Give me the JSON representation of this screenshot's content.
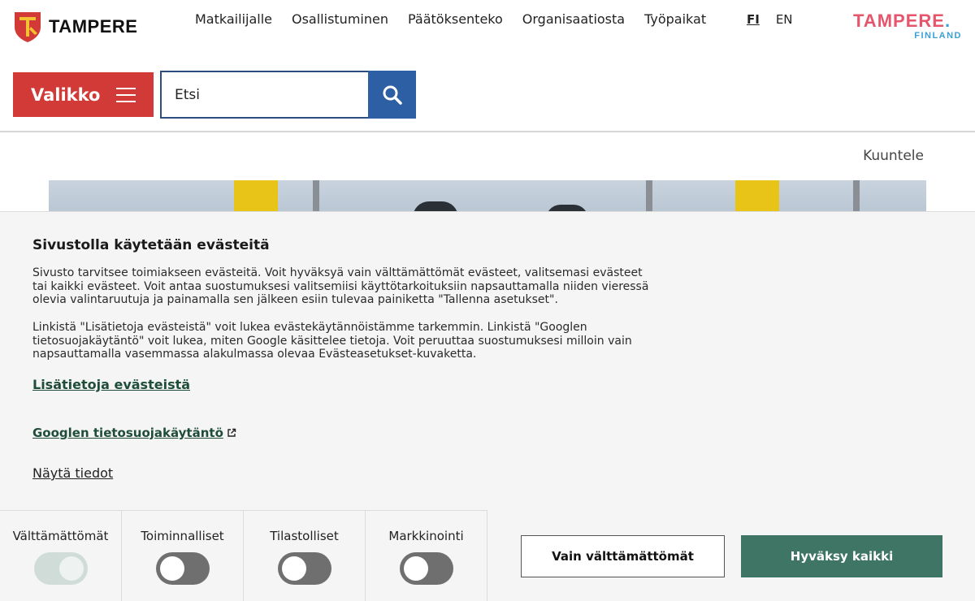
{
  "header": {
    "logo_text": "TAMPERE",
    "nav": [
      "Matkailijalle",
      "Osallistuminen",
      "Päätöksenteko",
      "Organisaatiosta",
      "Työpaikat"
    ],
    "lang_fi": "FI",
    "lang_en": "EN",
    "brand_main": "TAMPERE",
    "brand_dot": ".",
    "brand_sub": "FINLAND",
    "menu_label": "Valikko",
    "search_value": "Etsi",
    "colors": {
      "menu": "#d13a36",
      "search": "#2d5fa5",
      "brand": "#e5556b",
      "brand_accent": "#3aa0d6"
    }
  },
  "content": {
    "listen_label": "Kuuntele"
  },
  "cookie": {
    "title": "Sivustolla käytetään evästeitä",
    "paragraph1": "Sivusto tarvitsee toimiakseen evästeitä. Voit hyväksyä vain välttämättömät evästeet, valitsemasi evästeet tai kaikki evästeet. Voit antaa suostumuksesi valitsemiisi käyttötarkoituksiin napsauttamalla niiden vieressä olevia valintaruutuja ja painamalla sen jälkeen esiin tulevaa painiketta \"Tallenna asetukset\".",
    "paragraph2": "Linkistä \"Lisätietoja evästeistä\" voit lukea evästekäytännöistämme tarkemmin. Linkistä \"Googlen tietosuojakäytäntö\" voit lukea, miten Google käsittelee tietoja. Voit peruuttaa suostumuksesi milloin vain napsauttamalla vasemmassa alakulmassa olevaa Evästeasetukset-kuvaketta.",
    "link_more": "Lisätietoja evästeistä",
    "link_google": "Googlen tietosuojakäytäntö",
    "link_show": "Näytä tiedot",
    "categories": [
      {
        "label": "Välttämättömät",
        "state": "on-disabled"
      },
      {
        "label": "Toiminnalliset",
        "state": "off"
      },
      {
        "label": "Tilastolliset",
        "state": "off"
      },
      {
        "label": "Markkinointi",
        "state": "off"
      }
    ],
    "btn_necessary": "Vain välttämättömät",
    "btn_accept": "Hyväksy kaikki",
    "colors": {
      "accept": "#3e7565",
      "link": "#1f4d3a"
    }
  }
}
